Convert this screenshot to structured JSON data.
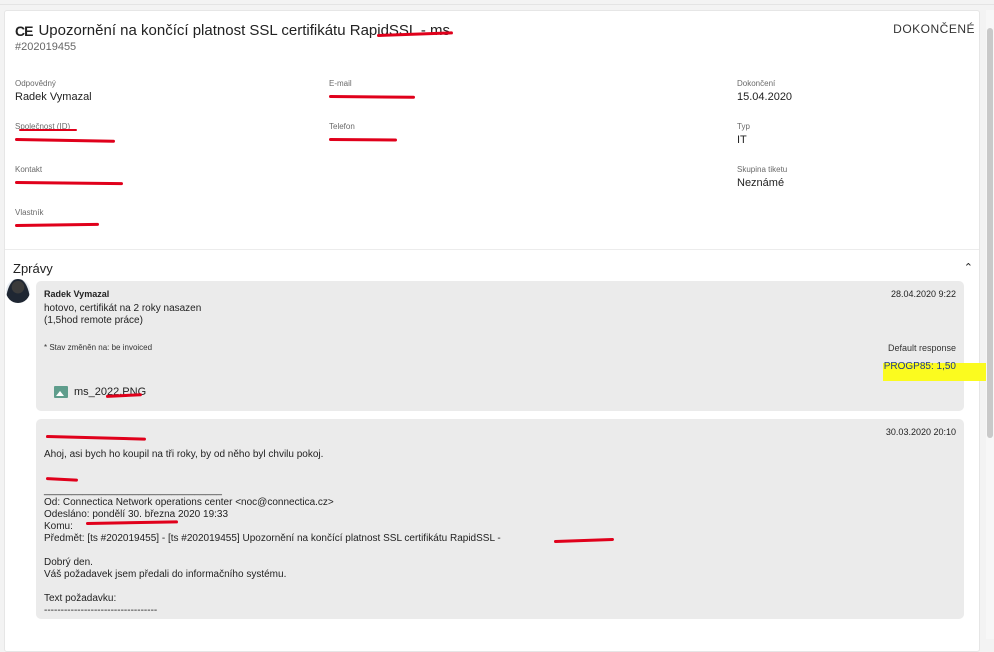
{
  "ticket": {
    "title": "Upozornění na končící platnost SSL certifikátu RapidSSL - ms",
    "id": "#202019455",
    "status": "DOKONČENÉ",
    "icon": "ce-logo-icon"
  },
  "fields": {
    "responsible_label": "Odpovědný",
    "responsible_value": "Radek Vymazal",
    "email_label": "E-mail",
    "email_value": "",
    "completion_label": "Dokončení",
    "completion_value": "15.04.2020",
    "company_label": "Společnost (ID)",
    "company_value": "",
    "phone_label": "Telefon",
    "phone_value": "",
    "type_label": "Typ",
    "type_value": "IT",
    "contact_label": "Kontakt",
    "contact_value": "",
    "group_label": "Skupina tiketu",
    "group_value": "Neznámé",
    "owner_label": "Vlastník",
    "owner_value": ""
  },
  "messages_section": {
    "title": "Zprávy",
    "collapse_icon": "chevron-up-icon"
  },
  "messages": [
    {
      "author": "Radek Vymazal",
      "date": "28.04.2020 9:22",
      "body": "hotovo, certifikát na 2 roky nasazen\n(1,5hod remote práce)",
      "note": "* Stav změněn na: be invoiced",
      "response_label": "Default response",
      "response_value": "PROGP85: 1,50",
      "attachment": "ms_2022.PNG",
      "attachment_icon": "image-icon"
    },
    {
      "author": "",
      "date": "30.03.2020 20:10",
      "body": "Ahoj, asi bych ho koupil na tři roky, by od něho byl chvilu pokoj.\n\n\n________________________________\nOd: Connectica Network operations center <noc@connectica.cz>\nOdesláno: pondělí 30. března 2020 19:33\nKomu: \nPředmět: [ts #202019455] - [ts #202019455] Upozornění na končící platnost SSL certifikátu RapidSSL - \n\nDobrý den.\nVáš požadavek jsem předali do informačního systému.\n\nText požadavku:\n----------------------------------"
    }
  ],
  "colors": {
    "redaction": "#e0001b",
    "highlight": "#fbfb1f",
    "message_bg": "#ebebeb"
  }
}
